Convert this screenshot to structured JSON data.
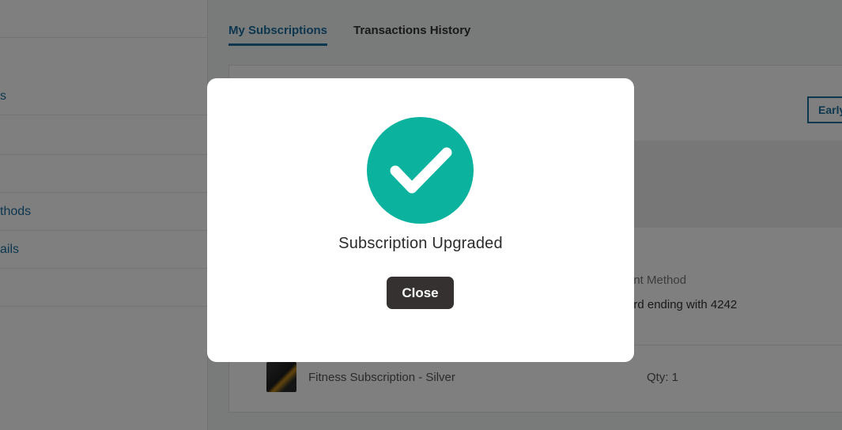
{
  "sidebar": {
    "items": [
      {
        "label": ""
      },
      {
        "label": "s"
      },
      {
        "label": ""
      },
      {
        "label": ""
      },
      {
        "label": "thods"
      },
      {
        "label": "ails"
      },
      {
        "label": ""
      }
    ]
  },
  "tabs": [
    {
      "label": "My Subscriptions",
      "active": true
    },
    {
      "label": "Transactions History",
      "active": false
    }
  ],
  "main": {
    "early_button_label": "Early",
    "payment_method_label": "ent Method",
    "payment_method_value": "ard ending with 4242",
    "product": {
      "name": "Fitness Subscription - Silver",
      "qty": "Qty: 1"
    }
  },
  "modal": {
    "icon": "check-circle-icon",
    "title": "Subscription Upgraded",
    "close_label": "Close",
    "accent_color": "#0bb39f",
    "button_color": "#353130"
  }
}
